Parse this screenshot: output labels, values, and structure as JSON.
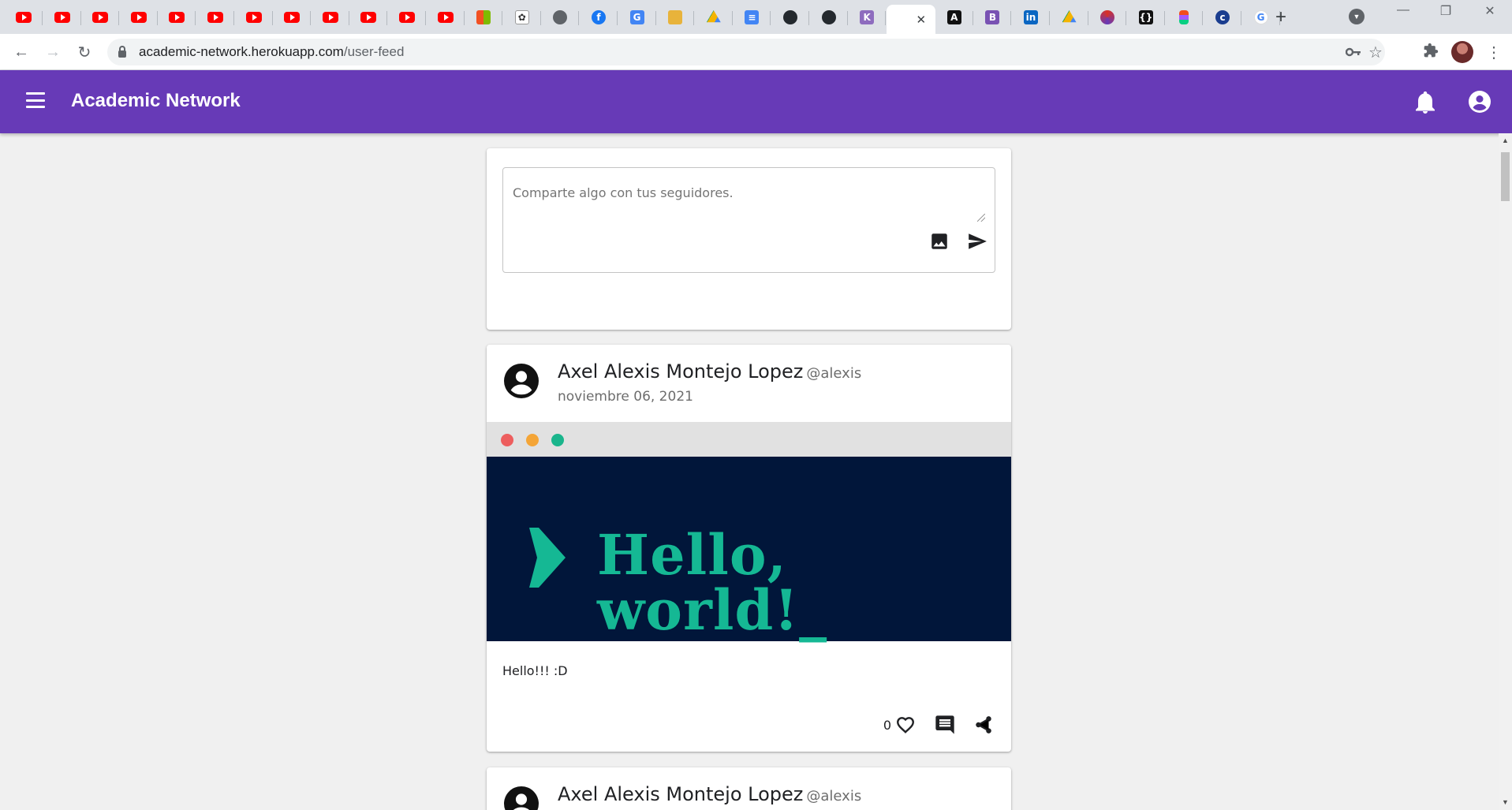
{
  "browser": {
    "address_host": "academic-network.herokuapp.com",
    "address_path": "/user-feed",
    "tab_favicons": [
      "youtube",
      "youtube",
      "youtube",
      "youtube",
      "youtube",
      "youtube",
      "youtube",
      "youtube",
      "youtube",
      "youtube",
      "youtube",
      "youtube",
      "microsoft",
      "accessibility",
      "globe",
      "facebook",
      "translate",
      "building",
      "drive",
      "docs",
      "github",
      "github",
      "k-letter",
      "active-page",
      "angular",
      "bootstrap",
      "linkedin",
      "drive",
      "spinner",
      "code-brackets",
      "figma",
      "cl-logo",
      "google"
    ]
  },
  "app": {
    "title": "Academic Network",
    "brand_color": "#673ab7"
  },
  "composer": {
    "placeholder": "Comparte algo con tus seguidores."
  },
  "posts": [
    {
      "author": "Axel Alexis Montejo Lopez",
      "handle": "@alexis",
      "date": "noviembre 06, 2021",
      "image_text": "Hello, world!_",
      "text": "Hello!!! :D",
      "likes": "0"
    },
    {
      "author": "Axel Alexis Montejo Lopez",
      "handle": "@alexis"
    }
  ]
}
